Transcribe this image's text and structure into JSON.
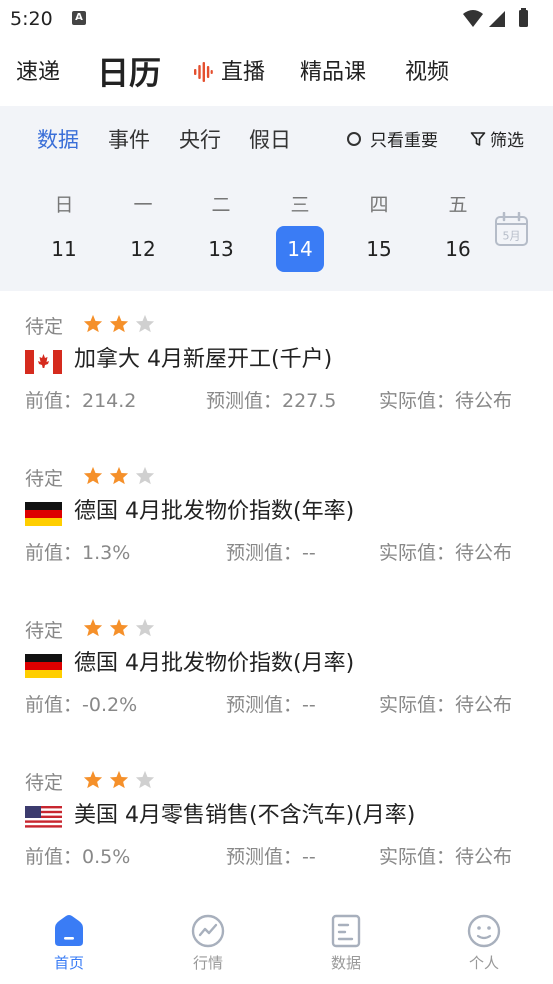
{
  "status_bar": {
    "time": "5:20",
    "a_icon": "A"
  },
  "top_nav": {
    "items": [
      "速递",
      "日历",
      "直播",
      "精品课",
      "视频"
    ],
    "active_index": 1
  },
  "sub_tabs": {
    "items": [
      "数据",
      "事件",
      "央行",
      "假日"
    ],
    "active_index": 0,
    "only_important": "只看重要",
    "filter": "筛选"
  },
  "calendar": {
    "weekdays": [
      "日",
      "一",
      "二",
      "三",
      "四",
      "五"
    ],
    "days": [
      "11",
      "12",
      "13",
      "14",
      "15",
      "16"
    ],
    "selected_index": 3,
    "month_label": "5月"
  },
  "events": [
    {
      "status": "待定",
      "stars": 2,
      "max_stars": 3,
      "flag": "canada",
      "title": "加拿大 4月新屋开工(千户)",
      "previous": "前值：214.2",
      "forecast": "预测值：227.5",
      "actual": "实际值：待公布"
    },
    {
      "status": "待定",
      "stars": 2,
      "max_stars": 3,
      "flag": "germany",
      "title": "德国 4月批发物价指数(年率)",
      "previous": "前值：1.3%",
      "forecast": "预测值：--",
      "actual": "实际值：待公布"
    },
    {
      "status": "待定",
      "stars": 2,
      "max_stars": 3,
      "flag": "germany",
      "title": "德国 4月批发物价指数(月率)",
      "previous": "前值：-0.2%",
      "forecast": "预测值：--",
      "actual": "实际值：待公布"
    },
    {
      "status": "待定",
      "stars": 2,
      "max_stars": 3,
      "flag": "usa",
      "title": "美国 4月零售销售(不含汽车)(月率)",
      "previous": "前值：0.5%",
      "forecast": "预测值：--",
      "actual": "实际值：待公布"
    }
  ],
  "bottom_nav": {
    "items": [
      {
        "label": "首页",
        "icon": "home-icon"
      },
      {
        "label": "行情",
        "icon": "market-icon"
      },
      {
        "label": "数据",
        "icon": "data-icon"
      },
      {
        "label": "个人",
        "icon": "profile-icon"
      }
    ],
    "active_index": 0
  },
  "colors": {
    "accent": "#3a7cf5",
    "tab_active": "#3a6fd8",
    "star_on": "#f5902a",
    "star_off": "#d0d0d0",
    "live_red": "#e4502f"
  }
}
